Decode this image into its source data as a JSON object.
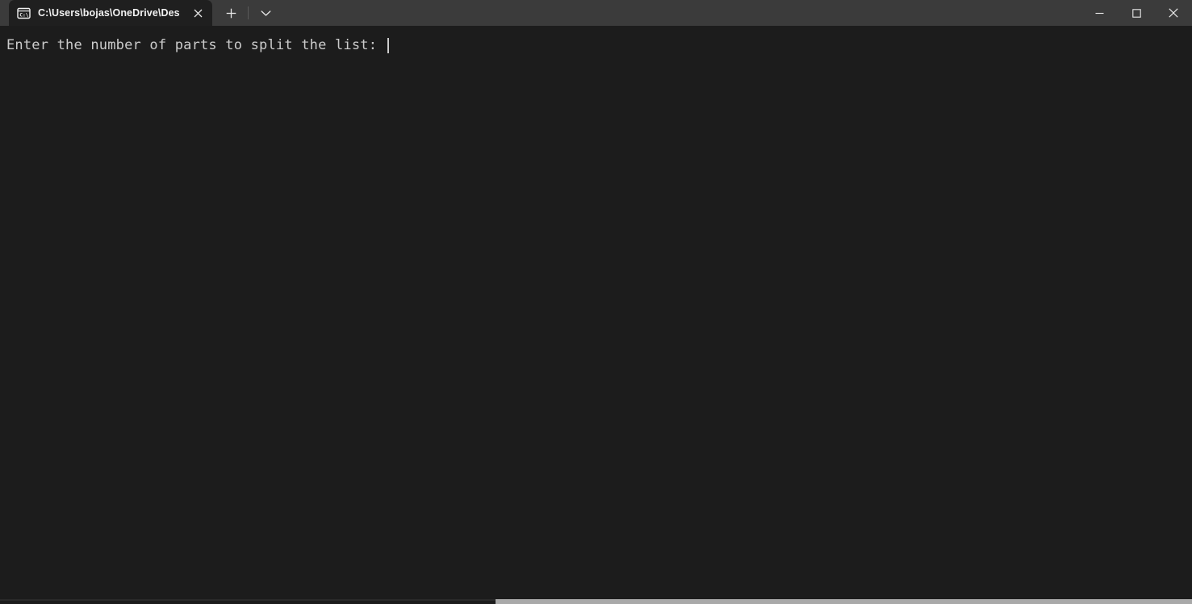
{
  "window": {
    "app_name": "Windows Terminal",
    "background_color": "#1c1c1c",
    "titlebar_color": "#3b3b3b"
  },
  "titlebar": {
    "tabs": [
      {
        "icon": "command-prompt-icon",
        "icon_label": "C:\\",
        "title": "C:\\Users\\bojas\\OneDrive\\Des",
        "active": true,
        "close_label": "✕"
      }
    ],
    "new_tab_label": "+",
    "dropdown_label": "⌄",
    "caption": {
      "minimize_label": "—",
      "maximize_label": "□",
      "close_label": "✕"
    }
  },
  "terminal": {
    "text_color": "#cccccc",
    "lines": [
      "Enter the number of parts to split the list: "
    ],
    "cursor_visible": true
  },
  "scrollbar": {
    "orientation": "horizontal",
    "thumb_color": "#a9a9a9"
  }
}
